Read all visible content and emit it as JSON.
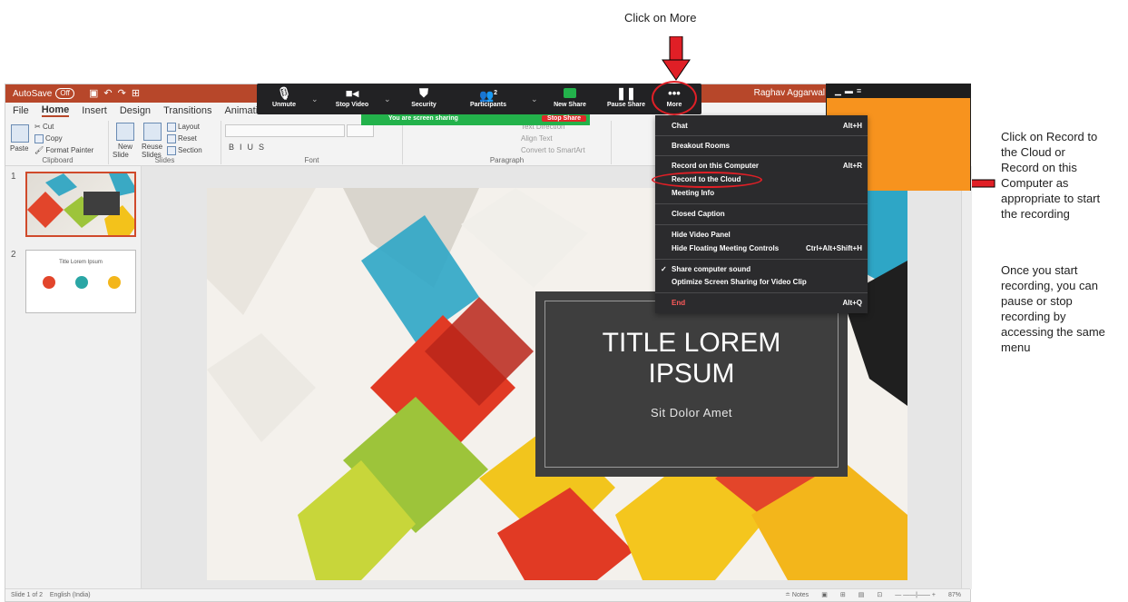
{
  "annotations": {
    "top": "Click on More",
    "right1": [
      "Click on Record to",
      "the Cloud or",
      "Record on this",
      "Computer as",
      "appropriate to start",
      "the recording"
    ],
    "right2": [
      "Once you start",
      "recording, you can",
      "pause or stop",
      "recording by",
      "accessing the same",
      "menu"
    ]
  },
  "ppt": {
    "autosave": "AutoSave",
    "autosave_state": "Off",
    "user": "Raghav Aggarwal",
    "tabs": [
      "File",
      "Home",
      "Insert",
      "Design",
      "Transitions",
      "Animations"
    ],
    "clipboard": {
      "paste": "Paste",
      "cut": "Cut",
      "copy": "Copy",
      "format_painter": "Format Painter",
      "label": "Clipboard"
    },
    "slides_group": {
      "new": "New",
      "slide": "Slide",
      "reuse": "Reuse",
      "slides": "Slides",
      "layout": "Layout",
      "reset": "Reset",
      "section": "Section",
      "label": "Slides"
    },
    "font_label": "Font",
    "paragraph": {
      "text_direction": "Text Direction",
      "align_text": "Align Text",
      "smartart": "Convert to SmartArt",
      "label": "Paragraph"
    },
    "thumb2_title": "Title Lorem Ipsum",
    "slide": {
      "title_line1": "TITLE LOREM",
      "title_line2": "IPSUM",
      "subtitle": "Sit Dolor Amet"
    },
    "status": {
      "slide_of": "Slide 1 of 2",
      "language": "English (India)",
      "notes": "Notes",
      "zoom": "87%"
    }
  },
  "zoom": {
    "toolbar": [
      {
        "name": "unmute",
        "label": "Unmute"
      },
      {
        "name": "stop-video",
        "label": "Stop Video"
      },
      {
        "name": "security",
        "label": "Security"
      },
      {
        "name": "participants",
        "label": "Participants",
        "count": "2"
      },
      {
        "name": "new-share",
        "label": "New Share"
      },
      {
        "name": "pause-share",
        "label": "Pause Share"
      },
      {
        "name": "more",
        "label": "More"
      }
    ],
    "sharing_text": "You are screen sharing",
    "stop_share": "Stop Share",
    "menu": {
      "chat": "Chat",
      "chat_sc": "Alt+H",
      "breakout": "Breakout Rooms",
      "rec_computer": "Record on this Computer",
      "rec_computer_sc": "Alt+R",
      "rec_cloud": "Record to the Cloud",
      "meeting_info": "Meeting Info",
      "closed_caption": "Closed Caption",
      "hide_video": "Hide Video Panel",
      "hide_controls": "Hide Floating Meeting Controls",
      "hide_controls_sc": "Ctrl+Alt+Shift+H",
      "share_sound": "Share computer sound",
      "optimize": "Optimize Screen Sharing for Video Clip",
      "end": "End",
      "end_sc": "Alt+Q"
    },
    "colors": {
      "toolbar_bg": "#222224",
      "green": "#23b24b",
      "red": "#e01f26",
      "menu_bg": "#2b2b2d",
      "ppt_brand": "#b7472a"
    }
  }
}
